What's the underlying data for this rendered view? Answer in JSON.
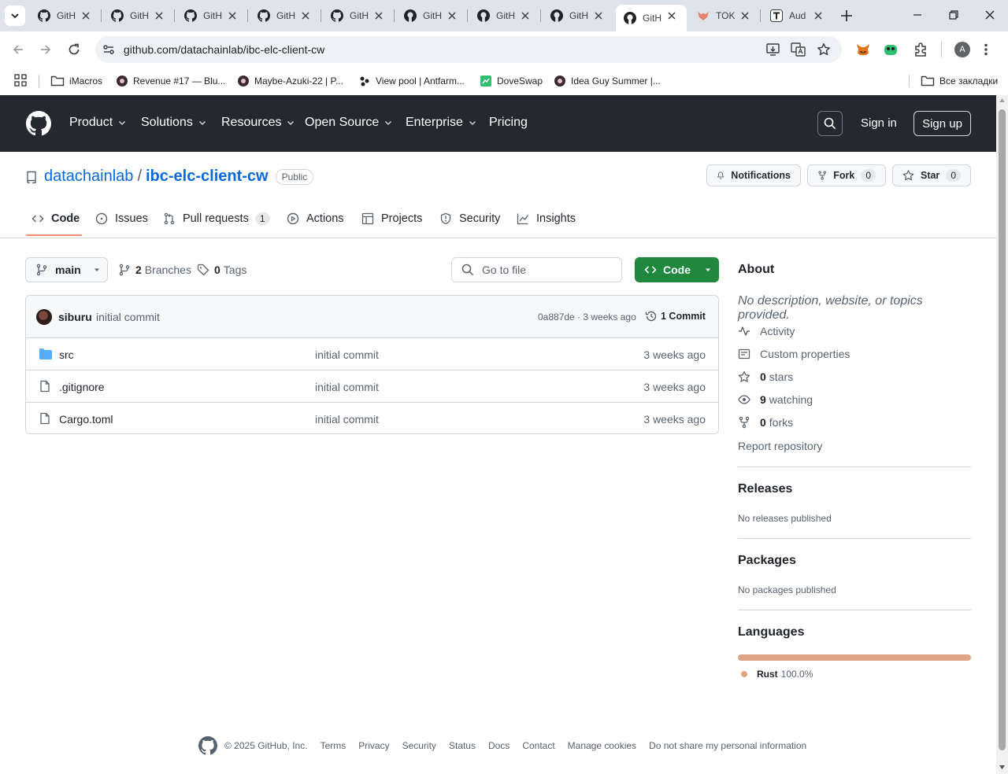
{
  "browser": {
    "tabs": [
      {
        "title": "GitH",
        "favicon": "github-icon",
        "active": false
      },
      {
        "title": "GitH",
        "favicon": "github-icon",
        "active": false
      },
      {
        "title": "GitH",
        "favicon": "github-icon",
        "active": false
      },
      {
        "title": "GitH",
        "favicon": "github-icon",
        "active": false
      },
      {
        "title": "GitH",
        "favicon": "github-icon",
        "active": false
      },
      {
        "title": "GitH",
        "favicon": "github-icon",
        "active": false
      },
      {
        "title": "GitH",
        "favicon": "github-icon",
        "active": false
      },
      {
        "title": "GitH",
        "favicon": "github-icon",
        "active": false
      },
      {
        "title": "GitH",
        "favicon": "github-icon",
        "active": true
      },
      {
        "title": "TOK",
        "favicon": "fox-icon",
        "active": false
      },
      {
        "title": "Aud",
        "favicon": "t-icon",
        "active": false
      }
    ],
    "url": "github.com/datachainlab/ibc-elc-client-cw",
    "profile_initial": "A",
    "bookmarks": [
      {
        "label": "iMacros"
      },
      {
        "label": "Revenue #17 — Blu..."
      },
      {
        "label": "Maybe-Azuki-22 | P..."
      },
      {
        "label": "View pool | Antfarm..."
      },
      {
        "label": "DoveSwap"
      },
      {
        "label": "Idea Guy Summer |..."
      }
    ],
    "all_bookmarks_label": "Все закладки"
  },
  "gh_header": {
    "nav": [
      "Product",
      "Solutions",
      "Resources",
      "Open Source",
      "Enterprise",
      "Pricing"
    ],
    "sign_in": "Sign in",
    "sign_up": "Sign up"
  },
  "repo": {
    "owner": "datachainlab",
    "name": "ibc-elc-client-cw",
    "visibility": "Public",
    "notifications_label": "Notifications",
    "fork_label": "Fork",
    "fork_count": "0",
    "star_label": "Star",
    "star_count": "0",
    "tabs": [
      {
        "label": "Code"
      },
      {
        "label": "Issues"
      },
      {
        "label": "Pull requests",
        "count": "1"
      },
      {
        "label": "Actions"
      },
      {
        "label": "Projects"
      },
      {
        "label": "Security"
      },
      {
        "label": "Insights"
      }
    ]
  },
  "main": {
    "branch": "main",
    "branches_count": "2",
    "branches_label": "Branches",
    "tags_count": "0",
    "tags_label": "Tags",
    "goto_placeholder": "Go to file",
    "code_button": "Code",
    "commit": {
      "author": "siburu",
      "message": "initial commit",
      "sha_time": "0a887de · 3 weeks ago",
      "count_label": "1 Commit"
    },
    "files": [
      {
        "name": "src",
        "type": "folder",
        "message": "initial commit",
        "date": "3 weeks ago"
      },
      {
        "name": ".gitignore",
        "type": "file",
        "message": "initial commit",
        "date": "3 weeks ago"
      },
      {
        "name": "Cargo.toml",
        "type": "file",
        "message": "initial commit",
        "date": "3 weeks ago"
      }
    ]
  },
  "sidebar": {
    "about_title": "About",
    "about_desc": "No description, website, or topics provided.",
    "activity": "Activity",
    "custom_properties": "Custom properties",
    "stars_count": "0",
    "stars_label": "stars",
    "watching_count": "9",
    "watching_label": "watching",
    "forks_count": "0",
    "forks_label": "forks",
    "report": "Report repository",
    "releases_title": "Releases",
    "releases_empty": "No releases published",
    "packages_title": "Packages",
    "packages_empty": "No packages published",
    "languages_title": "Languages",
    "languages": [
      {
        "name": "Rust",
        "percent": "100.0%",
        "color": "#dea584"
      }
    ]
  },
  "footer": {
    "copyright": "© 2025 GitHub, Inc.",
    "links": [
      "Terms",
      "Privacy",
      "Security",
      "Status",
      "Docs",
      "Contact",
      "Manage cookies",
      "Do not share my personal information"
    ]
  }
}
